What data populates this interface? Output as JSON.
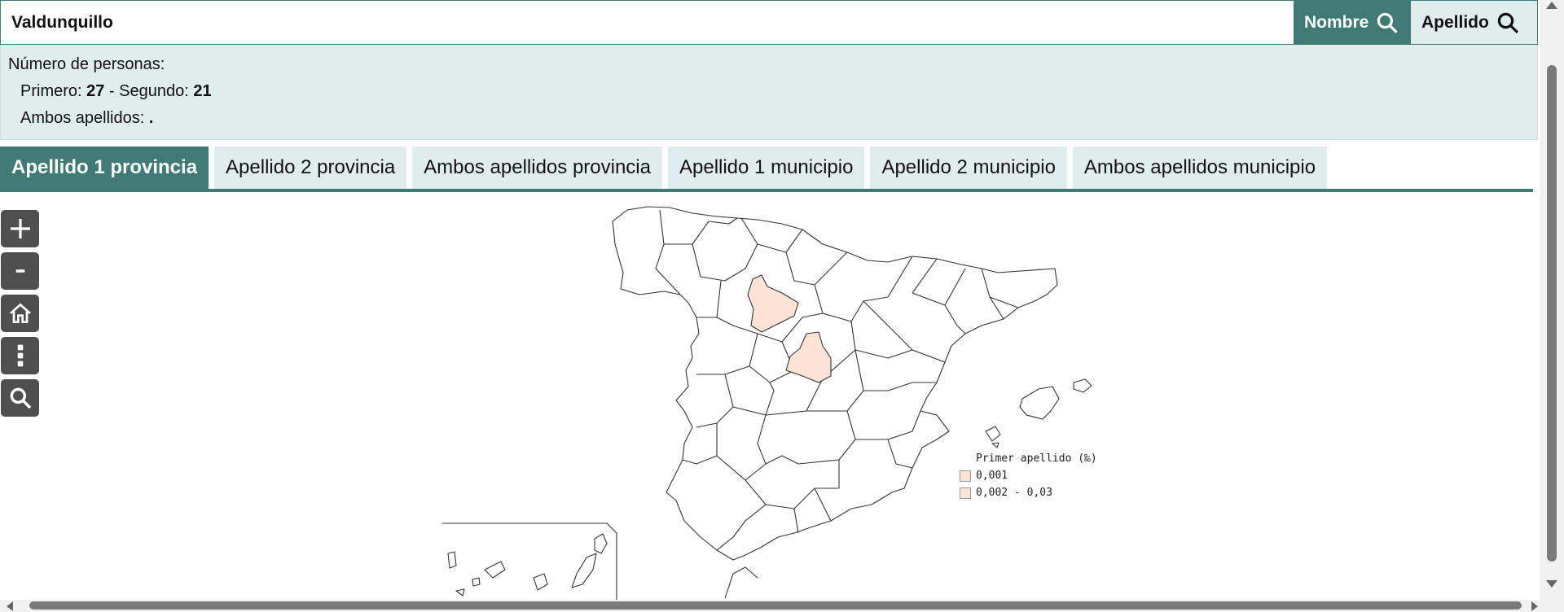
{
  "search": {
    "value": "Valdunquillo",
    "nombre_label": "Nombre",
    "apellido_label": "Apellido"
  },
  "info": {
    "heading": "Número de personas:",
    "primero_label": "Primero: ",
    "primero_value": "27",
    "segundo_label": " - Segundo: ",
    "segundo_value": "21",
    "ambos_label": "Ambos apellidos: ",
    "ambos_value": "."
  },
  "tabs": [
    {
      "label": "Apellido 1 provincia",
      "active": true
    },
    {
      "label": "Apellido 2 provincia",
      "active": false
    },
    {
      "label": "Ambos apellidos provincia",
      "active": false
    },
    {
      "label": "Apellido 1 municipio",
      "active": false
    },
    {
      "label": "Apellido 2 municipio",
      "active": false
    },
    {
      "label": "Ambos apellidos municipio",
      "active": false
    }
  ],
  "map_controls": [
    "zoom-in-icon",
    "zoom-out-icon",
    "home-icon",
    "more-vertical-icon",
    "search-icon"
  ],
  "map_controls_labels": {
    "zoom_in": "+",
    "zoom_out": "-"
  },
  "legend": {
    "title": "Primer apellido (‰)",
    "items": [
      {
        "label": "0,001",
        "color": "#fbe4d6"
      },
      {
        "label": "0,002 - 0,03",
        "color": "#fbe4d6"
      }
    ]
  },
  "colors": {
    "accent": "#3f7b74",
    "panel_bg": "#dfeeed",
    "highlight_fill": "#fbe4d6"
  }
}
